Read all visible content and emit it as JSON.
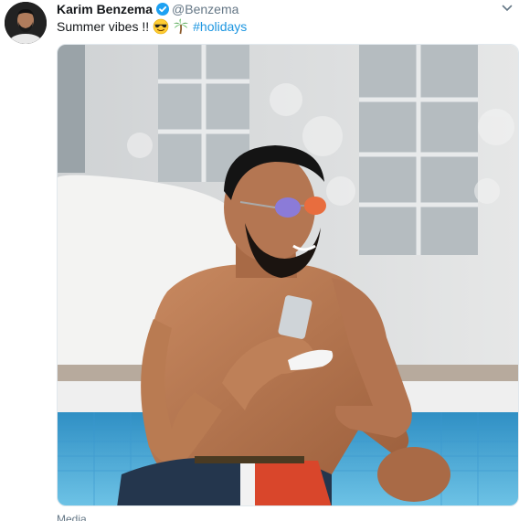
{
  "tweet": {
    "author_name": "Karim Benzema",
    "author_handle": "@Benzema",
    "verified": true,
    "text": "Summer vibes !!",
    "emojis": [
      "sunglasses-face-emoji",
      "palm-tree-emoji"
    ],
    "hashtag": "#holidays",
    "footer_text": "Media"
  },
  "colors": {
    "link": "#1b95e0",
    "verified": "#1da1f2",
    "secondary_text": "#657786",
    "primary_text": "#14171a"
  }
}
